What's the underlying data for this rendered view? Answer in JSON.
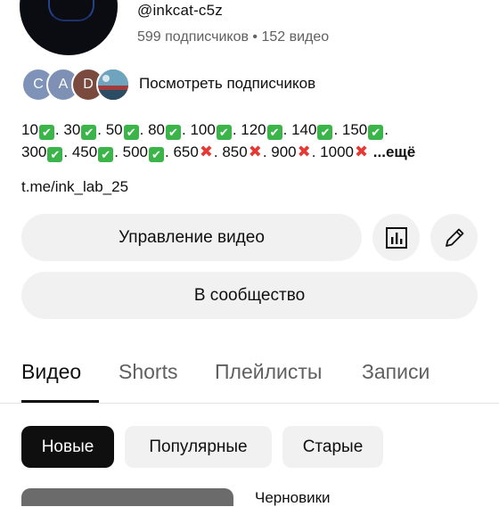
{
  "channel": {
    "handle": "@inkcat-c5z",
    "stats": "599 подписчиков • 152 видео"
  },
  "subscribers": {
    "avatars": [
      {
        "letter": "C",
        "color": "#7f93b8"
      },
      {
        "letter": "A",
        "color": "#7e91b4"
      },
      {
        "letter": "D",
        "color": "#7a4a3e"
      },
      {
        "letter": "",
        "color": "#3f6f85"
      }
    ],
    "link_label": "Посмотреть подписчиков"
  },
  "description": {
    "line1": [
      {
        "t": "10",
        "s": "ok"
      },
      {
        "t": ". 30",
        "s": "ok"
      },
      {
        "t": ". 50",
        "s": "ok"
      },
      {
        "t": ". 80",
        "s": "ok"
      },
      {
        "t": ". 100",
        "s": "ok"
      },
      {
        "t": ". 120",
        "s": "ok"
      },
      {
        "t": ". 140",
        "s": "ok"
      },
      {
        "t": ". 150",
        "s": "ok"
      },
      {
        "t": ".",
        "s": ""
      }
    ],
    "line2": [
      {
        "t": "300",
        "s": "ok"
      },
      {
        "t": ". 450",
        "s": "ok"
      },
      {
        "t": ". 500",
        "s": "ok"
      },
      {
        "t": ". 650",
        "s": "no"
      },
      {
        "t": ". 850",
        "s": "no"
      },
      {
        "t": ". 900",
        "s": "no"
      },
      {
        "t": ". 1000",
        "s": "no"
      }
    ],
    "more": " ...ещё",
    "link": "t.me/ink_lab_25"
  },
  "buttons": {
    "manage": "Управление видео",
    "community": "В сообщество"
  },
  "tabs": [
    {
      "label": "Видео",
      "active": true
    },
    {
      "label": "Shorts",
      "active": false
    },
    {
      "label": "Плейлисты",
      "active": false
    },
    {
      "label": "Записи",
      "active": false
    }
  ],
  "chips": [
    {
      "label": "Новые",
      "active": true
    },
    {
      "label": "Популярные",
      "active": false
    },
    {
      "label": "Старые",
      "active": false
    }
  ],
  "bottom": {
    "drafts": "Черновики"
  }
}
